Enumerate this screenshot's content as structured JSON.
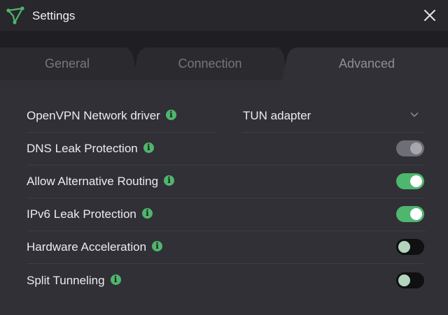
{
  "window": {
    "title": "Settings"
  },
  "tabs": [
    {
      "label": "General",
      "active": false
    },
    {
      "label": "Connection",
      "active": false
    },
    {
      "label": "Advanced",
      "active": true
    }
  ],
  "settings": {
    "driver": {
      "label": "OpenVPN Network driver",
      "value": "TUN adapter",
      "control": "dropdown"
    },
    "dns": {
      "label": "DNS Leak Protection",
      "state": "on-disabled"
    },
    "routing": {
      "label": "Allow Alternative Routing",
      "state": "on"
    },
    "ipv6": {
      "label": "IPv6 Leak Protection",
      "state": "on"
    },
    "hardware": {
      "label": "Hardware Acceleration",
      "state": "off"
    },
    "split": {
      "label": "Split Tunneling",
      "state": "off"
    }
  },
  "icons": {
    "info": "i",
    "logo": "protonvpn-logo-icon",
    "close": "close-icon",
    "chevron": "chevron-down-icon"
  },
  "colors": {
    "accent": "#4fb66e",
    "window_bg": "#303036",
    "titlebar_bg": "#27272c",
    "tabstrip_bg": "#1f1f23",
    "toggle_off": "#101012",
    "toggle_disabled": "#6e6e76"
  }
}
